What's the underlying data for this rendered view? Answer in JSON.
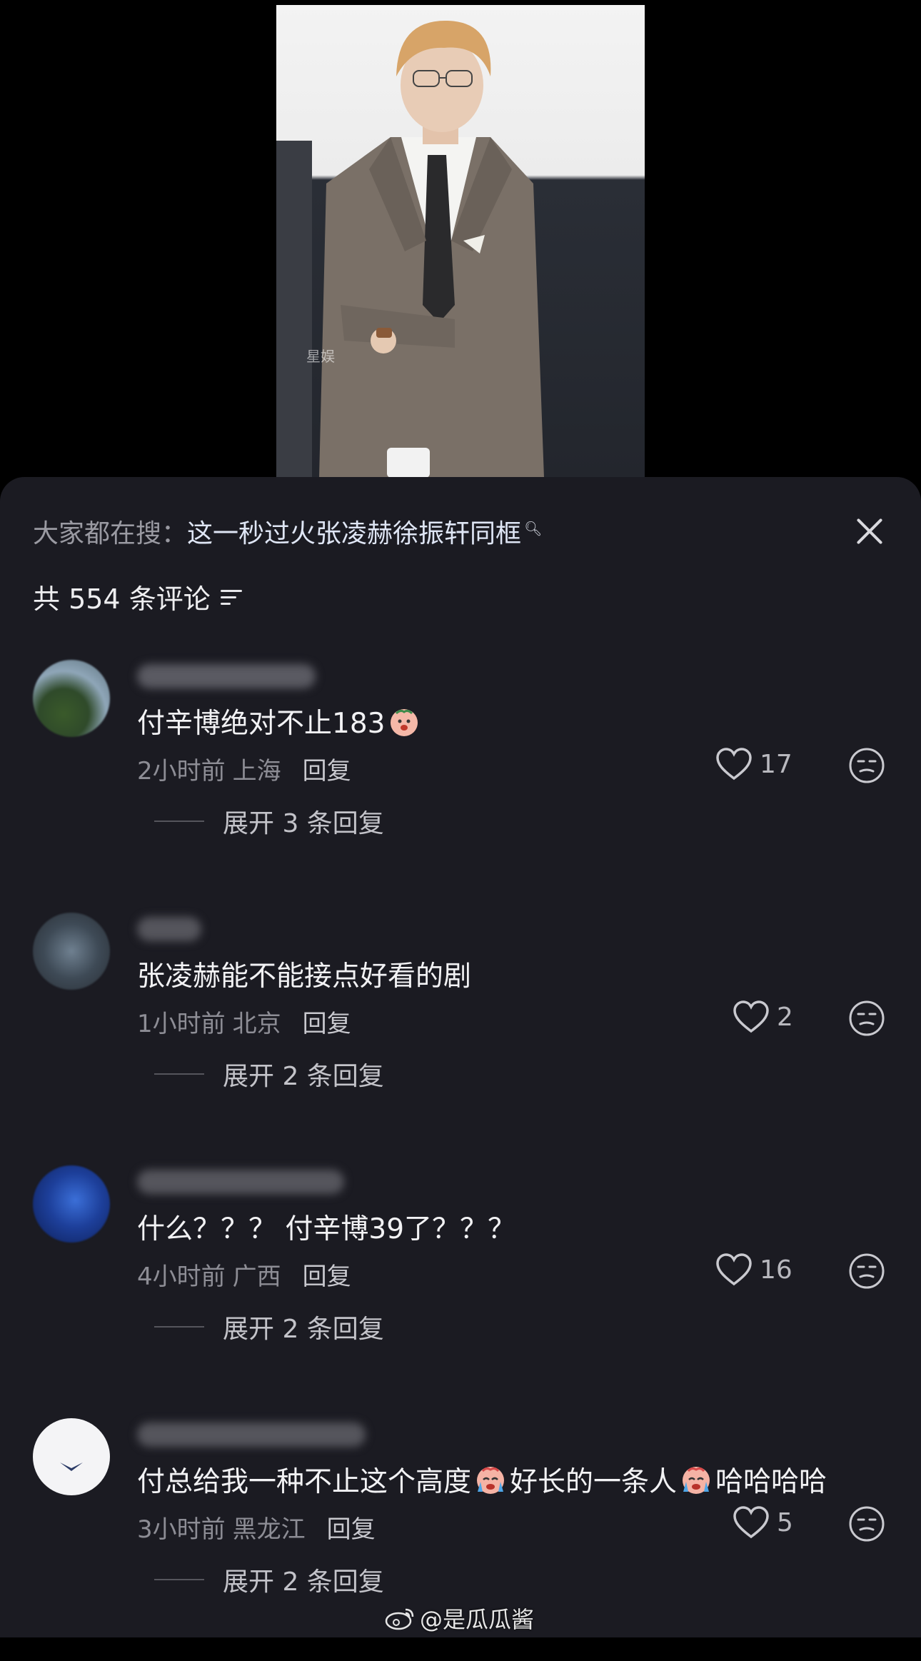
{
  "video": {
    "watermark": "星娱"
  },
  "sheet": {
    "search_prefix": "大家都在搜：",
    "search_term": "这一秒过火张凌赫徐振轩同框",
    "search_icon": "search-icon",
    "close_icon": "close-icon",
    "comment_count_label": "共 554 条评论",
    "sort_icon": "sort-filter-icon"
  },
  "comments": [
    {
      "text": "付辛博绝对不止183",
      "emoji_after": "crying-face-emoji",
      "time": "2小时前",
      "location": "上海",
      "reply_label": "回复",
      "likes": "17",
      "expand_label": "展开 3 条回复"
    },
    {
      "text": "张凌赫能不能接点好看的剧",
      "time": "1小时前",
      "location": "北京",
      "reply_label": "回复",
      "likes": "2",
      "expand_label": "展开 2 条回复"
    },
    {
      "text": "什么？？？ 付辛博39了？？？",
      "time": "4小时前",
      "location": "广西",
      "reply_label": "回复",
      "likes": "16",
      "expand_label": "展开 2 条回复"
    },
    {
      "text_part1": "付总给我一种不止这个高度",
      "text_part2": "好长的一条人",
      "text_part3": "哈哈哈哈",
      "emoji": "loudly-crying-emoji",
      "time": "3小时前",
      "location": "黑龙江",
      "reply_label": "回复",
      "likes": "5",
      "expand_label": "展开 2 条回复"
    }
  ],
  "icons": {
    "like": "heart-icon",
    "dislike": "meh-face-icon"
  },
  "watermark": {
    "text": "@是瓜瓜酱",
    "icon": "weibo-icon"
  },
  "colors": {
    "sheet_bg": "#1b1b22",
    "page_bg": "#000000",
    "text_primary": "#f2f2f4",
    "text_secondary": "#8d8d95"
  }
}
